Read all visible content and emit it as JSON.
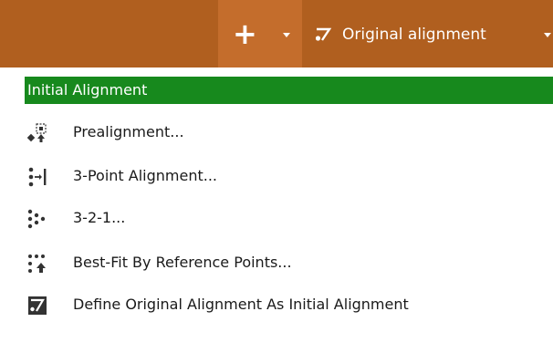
{
  "toolbar": {
    "add_button_glyph": "+",
    "alignment_dropdown_label": "Original alignment"
  },
  "menu": {
    "header": "Initial Alignment",
    "items": [
      {
        "label": "Prealignment...",
        "icon": "prealignment-icon"
      },
      {
        "label": "3-Point Alignment...",
        "icon": "three-point-alignment-icon"
      },
      {
        "label": "3-2-1...",
        "icon": "three-two-one-icon"
      },
      {
        "label": "Best-Fit By Reference Points...",
        "icon": "best-fit-reference-points-icon"
      },
      {
        "label": "Define Original Alignment As Initial Alignment",
        "icon": "define-original-alignment-icon"
      }
    ]
  },
  "colors": {
    "toolbar_bg": "#b05f1f",
    "toolbar_active_bg": "#c46d2c",
    "header_bg": "#17891d",
    "text_dark": "#1a1a1a"
  }
}
